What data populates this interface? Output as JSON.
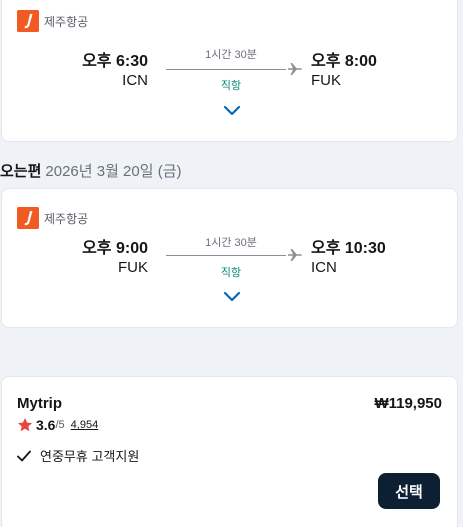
{
  "outbound": {
    "airline": "제주항공",
    "dep_time": "오후 6:30",
    "dep_code": "ICN",
    "duration": "1시간 30분",
    "stops": "직항",
    "arr_time": "오후 8:00",
    "arr_code": "FUK"
  },
  "return_header": {
    "label": "오는편",
    "date": "2026년 3월 20일 (금)"
  },
  "inbound": {
    "airline": "제주항공",
    "dep_time": "오후 9:00",
    "dep_code": "FUK",
    "duration": "1시간 30분",
    "stops": "직항",
    "arr_time": "오후 10:30",
    "arr_code": "ICN"
  },
  "offer": {
    "provider": "Mytrip",
    "price": "₩119,950",
    "rating": "3.6",
    "rating_max": "/5",
    "reviews": "4,954",
    "feature": "연중무휴 고객지원",
    "select_label": "선택"
  },
  "colors": {
    "brand_logo": "#f15a22",
    "nonstop": "#0b8a78",
    "chevron": "#0a6ab8",
    "star": "#e8473b",
    "button": "#0c1f33"
  },
  "icons": [
    "jeju-air-logo-icon",
    "airplane-icon",
    "chevron-down-icon",
    "star-icon",
    "checkmark-icon"
  ]
}
